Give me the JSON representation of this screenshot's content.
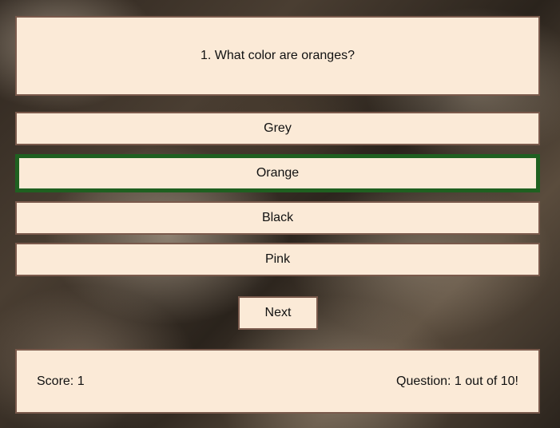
{
  "question": {
    "text": "1. What color are oranges?"
  },
  "answers": [
    {
      "label": "Grey",
      "selected": false
    },
    {
      "label": "Orange",
      "selected": true
    },
    {
      "label": "Black",
      "selected": false
    },
    {
      "label": "Pink",
      "selected": false
    }
  ],
  "controls": {
    "next_label": "Next"
  },
  "status": {
    "score": "Score: 1",
    "progress": "Question: 1 out of 10!"
  },
  "colors": {
    "panel_bg": "#fbead7",
    "panel_border": "#7a5a4c",
    "selected_border": "#1f6020"
  }
}
